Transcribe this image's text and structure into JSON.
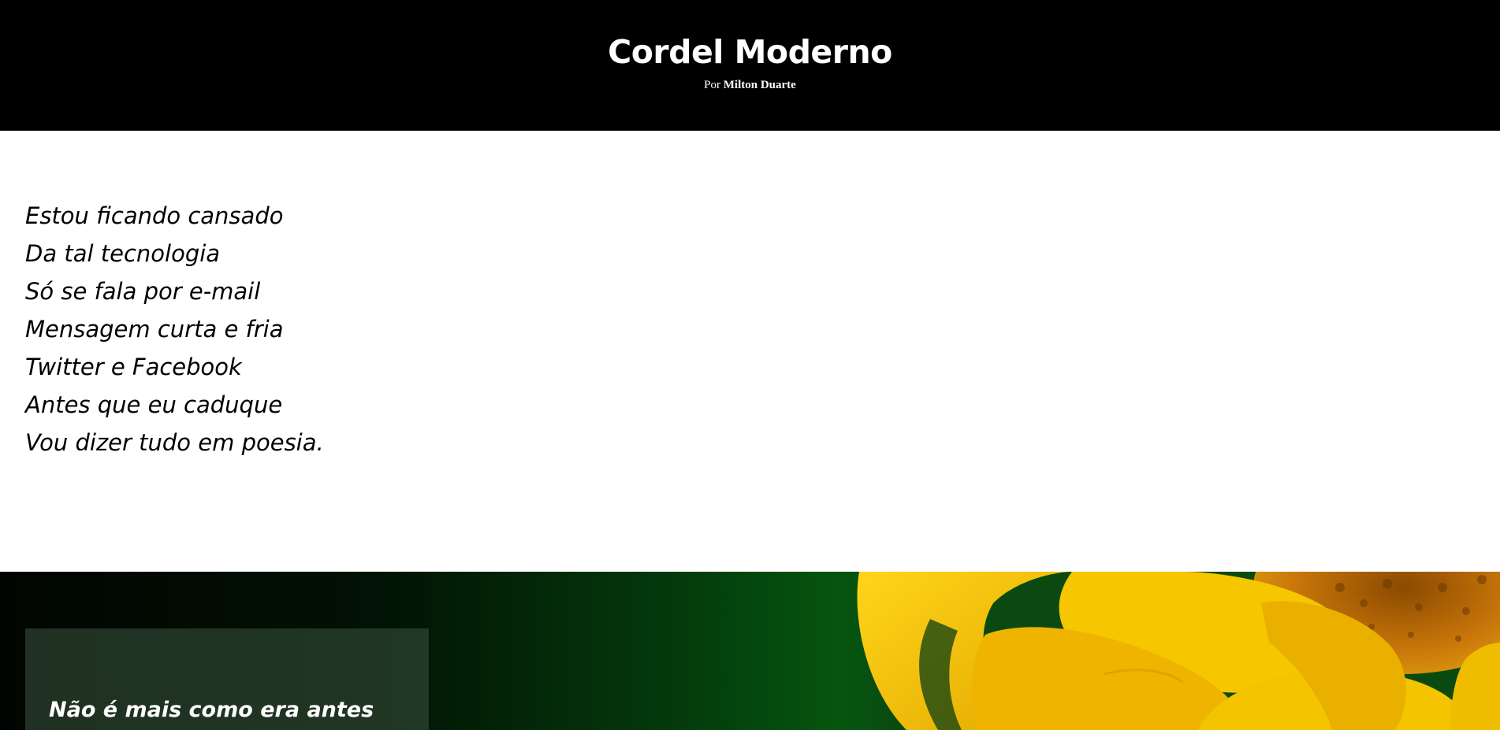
{
  "header": {
    "title": "Cordel Moderno",
    "byline_prefix": "Por",
    "author": "Milton Duarte",
    "background_color": "#000000"
  },
  "poem": {
    "lines": [
      "Estou ficando cansado",
      "Da tal tecnologia",
      "Só se fala por e-mail",
      "Mensagem curta e fria",
      "Twitter e Facebook",
      "Antes que eu caduque",
      "Vou dizer tudo em poesia."
    ]
  },
  "hero": {
    "image": "yellow-sunflower-closeup",
    "card_line": "Não é mais como era antes",
    "colors": {
      "petal": "#f3c300",
      "foliage": "#055510",
      "card": "#3a543e"
    }
  }
}
